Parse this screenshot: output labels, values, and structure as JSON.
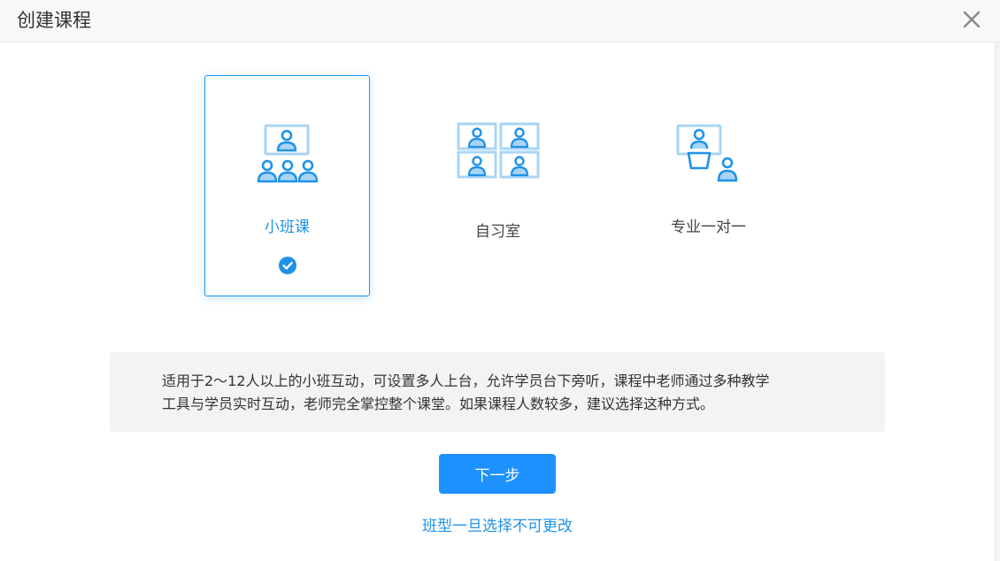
{
  "dialog": {
    "title": "创建课程"
  },
  "options": [
    {
      "id": "small-class",
      "label": "小班课",
      "selected": true,
      "icon": "small-class-icon"
    },
    {
      "id": "study-room",
      "label": "自习室",
      "selected": false,
      "icon": "study-room-icon"
    },
    {
      "id": "one-on-one",
      "label": "专业一对一",
      "selected": false,
      "icon": "one-on-one-icon"
    }
  ],
  "description": {
    "line1": "适用于2～12人以上的小班互动，可设置多人上台，允许学员台下旁听，课程中老师通过多种教学",
    "line2": "工具与学员实时互动，老师完全掌控整个课堂。如果课程人数较多，建议选择这种方式。"
  },
  "actions": {
    "next_label": "下一步"
  },
  "footer": {
    "note": "班型一旦选择不可更改"
  },
  "colors": {
    "accent": "#1e92e8",
    "button": "#1e92ff",
    "icon_light": "#a9d4f5"
  }
}
